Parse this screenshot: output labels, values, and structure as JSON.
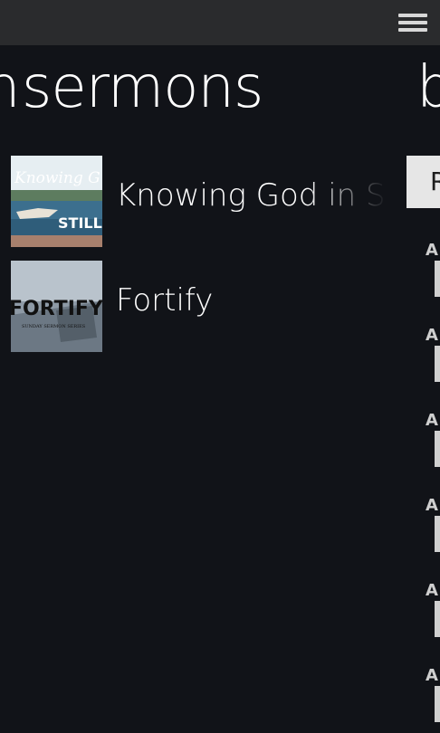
{
  "pivot": {
    "prev_header": "n",
    "title": "sermons",
    "next_header": "b"
  },
  "sermons": [
    {
      "title": "Knowing God in Stillness",
      "thumb_text_top": "Knowing G",
      "thumb_text_bottom": "STILLN"
    },
    {
      "title": "Fortify",
      "thumb_text_top": "FORTIFY",
      "thumb_text_bottom": "SUNDAY SERMON SERIES"
    }
  ],
  "right_panel": {
    "button_label": "R",
    "date_letters": [
      "A",
      "A",
      "A",
      "A",
      "A",
      "A"
    ]
  }
}
